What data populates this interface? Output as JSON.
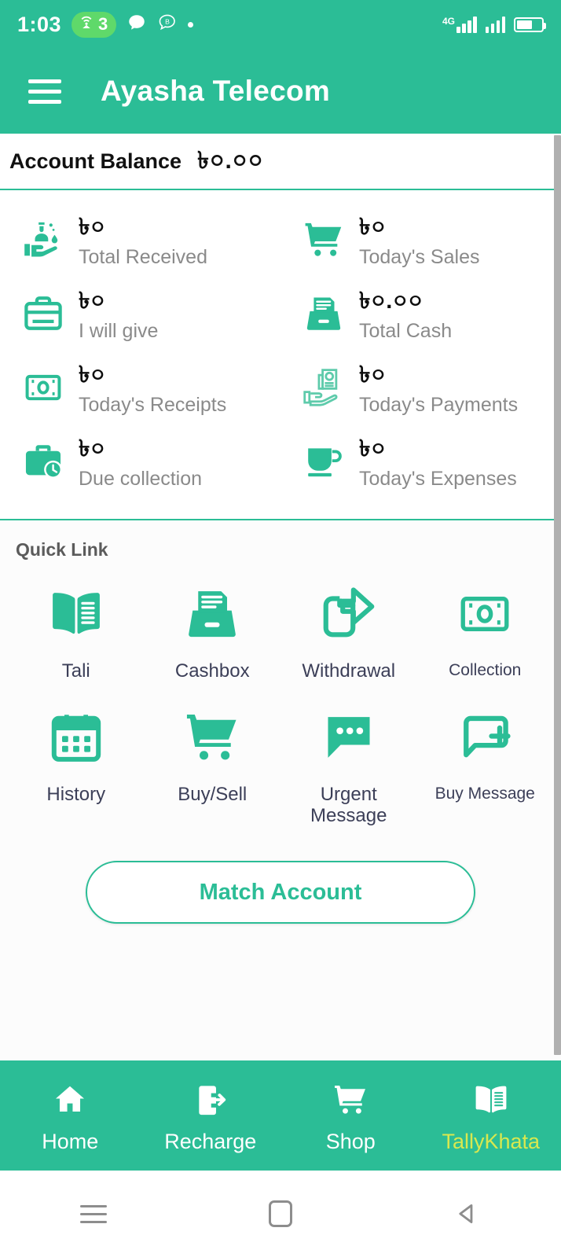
{
  "status_bar": {
    "time": "1:03",
    "hotspot_count": "3",
    "hotspot_icon": "wifi-hotspot-icon",
    "chat_icon": "message-bubble-icon",
    "bkash_icon": "bkash-b-icon",
    "dot_icon": "notification-dot-icon",
    "network_label": "4G",
    "signal_icon": "signal-bars-icon",
    "battery_icon": "battery-icon"
  },
  "app_bar": {
    "menu_icon": "hamburger-menu-icon",
    "title": "Ayasha Telecom"
  },
  "balance": {
    "label": "Account Balance",
    "value": "৳০.০০"
  },
  "summary": {
    "items": [
      {
        "icon": "hand-receiving-money-icon",
        "amount": "৳০",
        "label": "Total Received"
      },
      {
        "icon": "shopping-cart-icon",
        "amount": "৳০",
        "label": "Today's Sales"
      },
      {
        "icon": "briefcase-icon",
        "amount": "৳০",
        "label": "I will give"
      },
      {
        "icon": "cashbox-icon",
        "amount": "৳০.০০",
        "label": "Total Cash"
      },
      {
        "icon": "banknote-icon",
        "amount": "৳০",
        "label": "Today's Receipts"
      },
      {
        "icon": "hand-holding-invoice-icon",
        "amount": "৳০",
        "label": "Today's Payments"
      },
      {
        "icon": "briefcase-clock-icon",
        "amount": "৳০",
        "label": "Due collection"
      },
      {
        "icon": "coffee-cup-icon",
        "amount": "৳০",
        "label": "Today's Expenses"
      }
    ]
  },
  "quick_link": {
    "title": "Quick Link",
    "items": [
      {
        "icon": "open-book-icon",
        "label": "Tali"
      },
      {
        "icon": "cashbox-icon",
        "label": "Cashbox"
      },
      {
        "icon": "withdrawal-arrow-icon",
        "label": "Withdrawal"
      },
      {
        "icon": "banknote-icon",
        "label": "Collection"
      },
      {
        "icon": "calendar-icon",
        "label": "History"
      },
      {
        "icon": "shopping-cart-icon",
        "label": "Buy/Sell"
      },
      {
        "icon": "chat-bubble-dots-icon",
        "label": "Urgent Message"
      },
      {
        "icon": "chat-bubble-plus-icon",
        "label": "Buy Message"
      }
    ],
    "match_button": "Match Account"
  },
  "bottom_nav": {
    "items": [
      {
        "icon": "home-icon",
        "label": "Home",
        "active": false
      },
      {
        "icon": "phone-arrow-icon",
        "label": "Recharge",
        "active": false
      },
      {
        "icon": "shopping-cart-icon",
        "label": "Shop",
        "active": false
      },
      {
        "icon": "open-book-icon",
        "label": "TallyKhata",
        "active": true
      }
    ]
  },
  "android_nav": {
    "recents_icon": "recents-icon",
    "home_icon": "home-square-icon",
    "back_icon": "back-triangle-icon"
  },
  "colors": {
    "brand_green": "#2bbd96",
    "accent_yellow": "#d8e84f",
    "hotspot_green": "#5fd96a",
    "label_gray": "#8a8a8a",
    "quick_label": "#3c3f58"
  }
}
